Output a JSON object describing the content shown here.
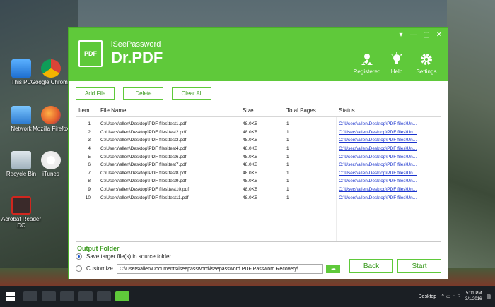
{
  "desktop": {
    "icons": [
      {
        "label": "This PC"
      },
      {
        "label": "Google Chrome"
      },
      {
        "label": "Network"
      },
      {
        "label": "Mozilla Firefox"
      },
      {
        "label": "Recycle Bin"
      },
      {
        "label": "iTunes"
      },
      {
        "label": "Acrobat Reader DC"
      }
    ]
  },
  "taskbar": {
    "desktop_label": "Desktop",
    "time": "5:01 PM",
    "date": "3/1/2016"
  },
  "app": {
    "brand_small": "iSeePassword",
    "brand_big": "Dr.PDF",
    "logo_text": "PDF",
    "header_buttons": {
      "registered": "Registered",
      "help": "Help",
      "settings": "Settings"
    },
    "toolbar": {
      "add_file": "Add File",
      "delete": "Delete",
      "clear_all": "Clear All"
    },
    "table": {
      "columns": [
        "Item",
        "File Name",
        "Size",
        "Total Pages",
        "Status"
      ],
      "rows": [
        {
          "item": "1",
          "name": "C:\\Users\\allen\\Desktop\\PDF files\\test1.pdf",
          "size": "48.0KB",
          "pages": "1",
          "status": "C:\\Users\\allen\\Desktop\\PDF files\\Un..."
        },
        {
          "item": "2",
          "name": "C:\\Users\\allen\\Desktop\\PDF files\\test2.pdf",
          "size": "48.0KB",
          "pages": "1",
          "status": "C:\\Users\\allen\\Desktop\\PDF files\\Un..."
        },
        {
          "item": "3",
          "name": "C:\\Users\\allen\\Desktop\\PDF files\\test3.pdf",
          "size": "48.0KB",
          "pages": "1",
          "status": "C:\\Users\\allen\\Desktop\\PDF files\\Un..."
        },
        {
          "item": "4",
          "name": "C:\\Users\\allen\\Desktop\\PDF files\\test4.pdf",
          "size": "48.0KB",
          "pages": "1",
          "status": "C:\\Users\\allen\\Desktop\\PDF files\\Un..."
        },
        {
          "item": "5",
          "name": "C:\\Users\\allen\\Desktop\\PDF files\\test6.pdf",
          "size": "48.0KB",
          "pages": "1",
          "status": "C:\\Users\\allen\\Desktop\\PDF files\\Un..."
        },
        {
          "item": "6",
          "name": "C:\\Users\\allen\\Desktop\\PDF files\\test7.pdf",
          "size": "48.0KB",
          "pages": "1",
          "status": "C:\\Users\\allen\\Desktop\\PDF files\\Un..."
        },
        {
          "item": "7",
          "name": "C:\\Users\\allen\\Desktop\\PDF files\\test8.pdf",
          "size": "48.0KB",
          "pages": "1",
          "status": "C:\\Users\\allen\\Desktop\\PDF files\\Un..."
        },
        {
          "item": "8",
          "name": "C:\\Users\\allen\\Desktop\\PDF files\\test9.pdf",
          "size": "48.0KB",
          "pages": "1",
          "status": "C:\\Users\\allen\\Desktop\\PDF files\\Un..."
        },
        {
          "item": "9",
          "name": "C:\\Users\\allen\\Desktop\\PDF files\\test10.pdf",
          "size": "48.0KB",
          "pages": "1",
          "status": "C:\\Users\\allen\\Desktop\\PDF files\\Un..."
        },
        {
          "item": "10",
          "name": "C:\\Users\\allen\\Desktop\\PDF files\\test11.pdf",
          "size": "48.0KB",
          "pages": "1",
          "status": "C:\\Users\\allen\\Desktop\\PDF files\\Un..."
        }
      ]
    },
    "output": {
      "title": "Output Folder",
      "option_source": "Save targer file(s) in source folder",
      "option_custom": "Customize",
      "custom_path": "C:\\Users\\allen\\Documents\\iseepassword\\iseepassword PDF Password Recovery\\",
      "browse_label": "•••"
    },
    "actions": {
      "back": "Back",
      "start": "Start"
    }
  },
  "colors": {
    "brand_green": "#5fc93a",
    "link_blue": "#1a33cc"
  }
}
